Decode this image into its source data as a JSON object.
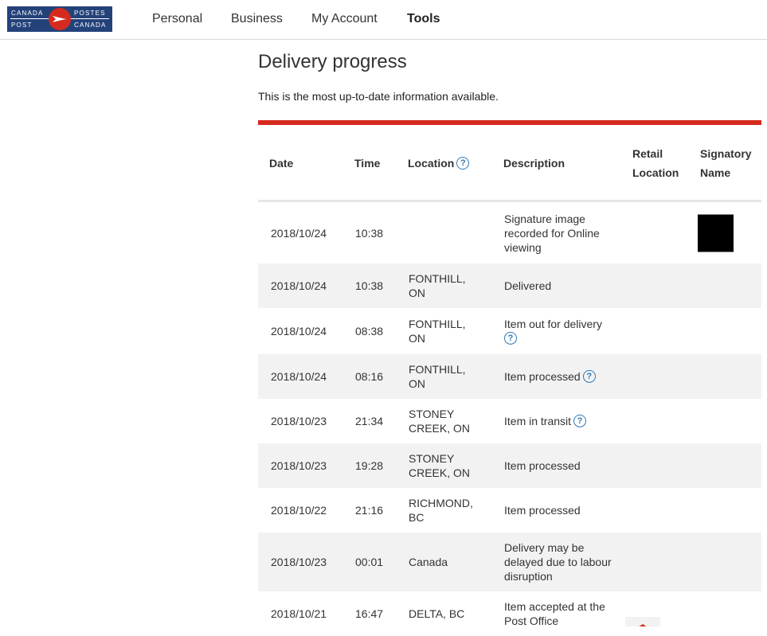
{
  "logo": {
    "line1_left": "CANADA",
    "line1_right": "POSTES",
    "line2_left": "POST",
    "line2_right": "CANADA",
    "colors": {
      "blue": "#24427a",
      "red": "#d52b1e"
    }
  },
  "nav": {
    "items": [
      {
        "label": "Personal"
      },
      {
        "label": "Business"
      },
      {
        "label": "My Account"
      },
      {
        "label": "Tools"
      }
    ]
  },
  "page": {
    "title": "Delivery progress",
    "subtitle": "This is the most up-to-date information available."
  },
  "table": {
    "headers": {
      "date": "Date",
      "time": "Time",
      "location": "Location",
      "description": "Description",
      "retail_line1": "Retail",
      "retail_line2": "Location",
      "signatory_line1": "Signatory",
      "signatory_line2": "Name"
    },
    "rows": [
      {
        "date": "2018/10/24",
        "time": "10:38",
        "location": "",
        "description": "Signature image recorded for Online viewing"
      },
      {
        "date": "2018/10/24",
        "time": "10:38",
        "location": "FONTHILL, ON",
        "description": "Delivered"
      },
      {
        "date": "2018/10/24",
        "time": "08:38",
        "location": "FONTHILL, ON",
        "description": "Item out for delivery"
      },
      {
        "date": "2018/10/24",
        "time": "08:16",
        "location": "FONTHILL, ON",
        "description": "Item processed"
      },
      {
        "date": "2018/10/23",
        "time": "21:34",
        "location": "STONEY CREEK, ON",
        "description": "Item in transit"
      },
      {
        "date": "2018/10/23",
        "time": "19:28",
        "location": "STONEY CREEK, ON",
        "description": "Item processed"
      },
      {
        "date": "2018/10/22",
        "time": "21:16",
        "location": "RICHMOND, BC",
        "description": "Item processed"
      },
      {
        "date": "2018/10/23",
        "time": "00:01",
        "location": "Canada",
        "description": "Delivery may be delayed due to labour disruption"
      },
      {
        "date": "2018/10/21",
        "time": "16:47",
        "location": "DELTA, BC",
        "description": "Item accepted at the Post Office"
      }
    ]
  },
  "icons": {
    "help": "question-circle-icon",
    "signature": "signature-image",
    "retail": "post-office-icon"
  },
  "accent_color": "#d52b1e",
  "help_color": "#2f7ab9"
}
